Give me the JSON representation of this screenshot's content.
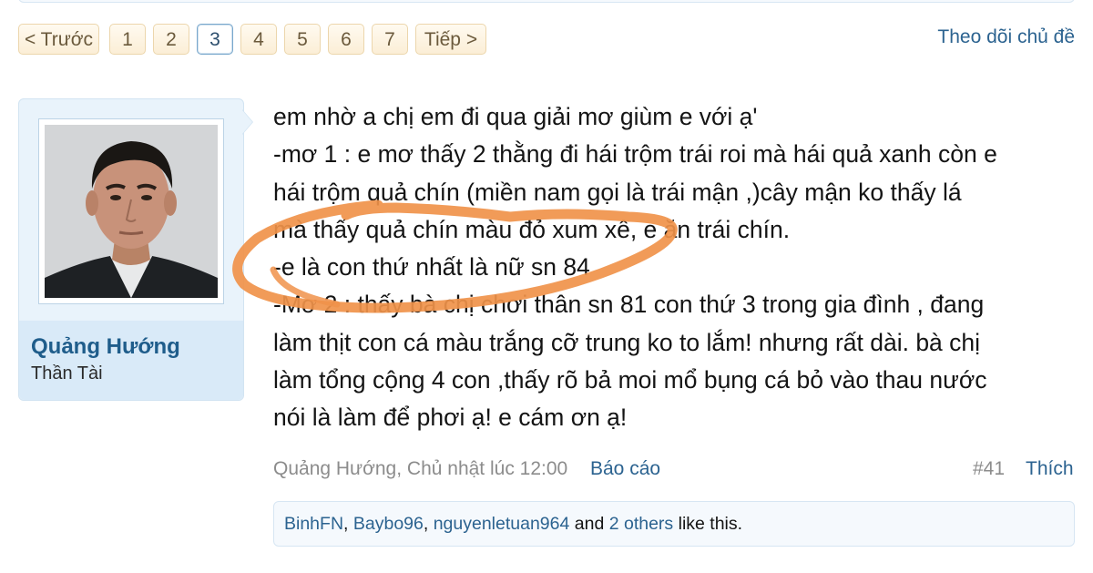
{
  "pagination": {
    "prev": "< Trước",
    "pages": [
      "1",
      "2",
      "3",
      "4",
      "5",
      "6",
      "7"
    ],
    "current": "3",
    "next": "Tiếp >"
  },
  "follow_link": "Theo dõi chủ đề",
  "author": {
    "name": "Quảng Hướng",
    "title": "Thần Tài"
  },
  "message_lines": [
    "em nhờ a chị em đi qua giải mơ giùm e với ạ'",
    "-mơ 1 : e mơ thấy 2 thằng đi hái trộm trái roi mà hái quả xanh còn e",
    "hái trộm quả chín (miền nam gọi là trái mận ,)cây mận ko thấy lá",
    "mà thấy quả chín màu đỏ xum xê, e ăn trái chín.",
    "-e là con thứ nhất là nữ sn 84",
    "-Mơ 2 : thấy bà chị chơi thân sn 81 con thứ 3 trong gia đình , đang",
    "làm thịt con cá màu trắng cỡ trung ko to lắm! nhưng rất dài. bà chị",
    "làm tổng cộng 4 con ,thấy rõ bả moi mổ bụng cá bỏ vào thau nước",
    "nói là làm để phơi ạ! e cám ơn ạ!"
  ],
  "post_meta": {
    "author_time": "Quảng Hướng, Chủ nhật lúc 12:00",
    "report": "Báo cáo",
    "post_number": "#41",
    "like": "Thích"
  },
  "likes": {
    "user1": "BinhFN",
    "sep1": ", ",
    "user2": "Baybo96",
    "sep2": ", ",
    "user3": "nguyenletuan964",
    "and": " and ",
    "others": "2 others",
    "suffix": " like this."
  },
  "colors": {
    "link": "#2c6390",
    "username": "#1f5d8b",
    "annotation": "#f0924a",
    "card_bg": "#e9f3fb"
  }
}
